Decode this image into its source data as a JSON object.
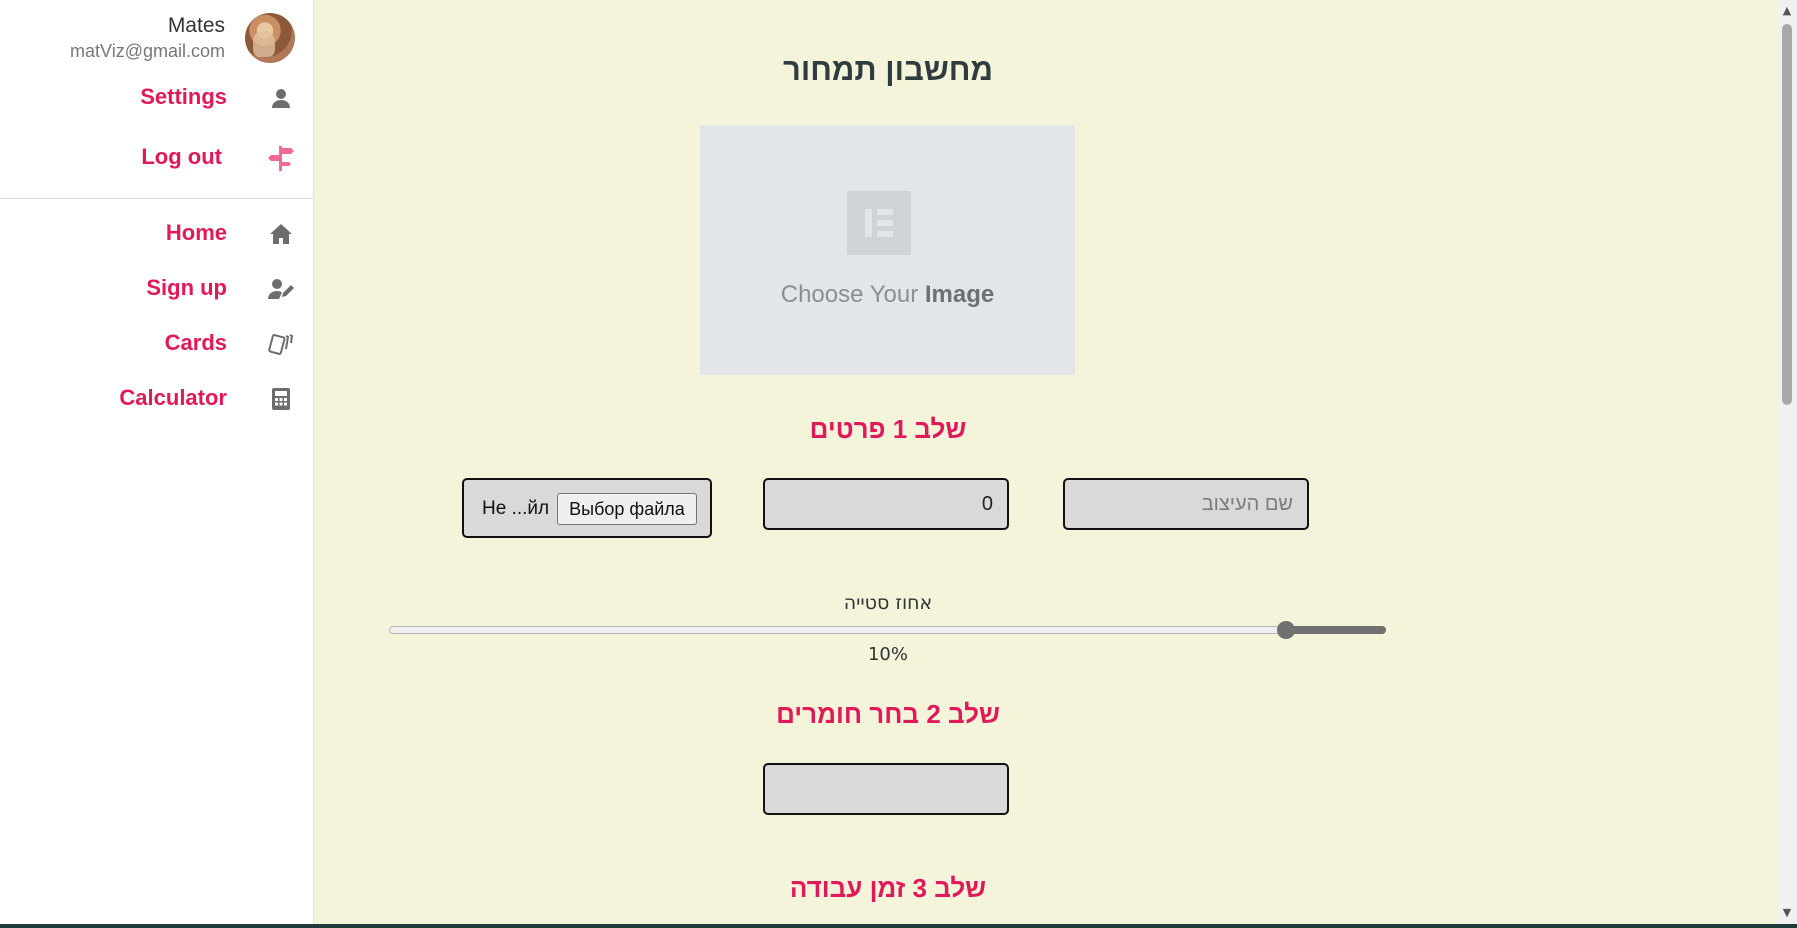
{
  "user": {
    "name": "Mates",
    "email": "matViz@gmail.com"
  },
  "account_menu": [
    {
      "label": "Settings",
      "icon": "person-icon"
    },
    {
      "label": "Log out",
      "icon": "signpost-icon"
    }
  ],
  "nav": [
    {
      "label": "Home",
      "icon": "home-icon"
    },
    {
      "label": "Sign up",
      "icon": "user-edit-icon"
    },
    {
      "label": "Cards",
      "icon": "cards-icon"
    },
    {
      "label": "Calculator",
      "icon": "calculator-icon"
    }
  ],
  "main": {
    "title": "מחשבון תמחור",
    "image_placeholder": {
      "caption_prefix": "Choose Your",
      "caption_bold": "Image"
    },
    "step1": {
      "heading": "שלב 1 פרטים",
      "design_name_placeholder": "שם העיצוב",
      "number_value": "0",
      "file_button_label": "Выбор файла",
      "file_status": "He ...йл"
    },
    "slider": {
      "label": "אחוז סטייה",
      "value": 0.9,
      "value_text": "10%"
    },
    "step2": {
      "heading": "שלב 2 בחר חומרים",
      "select_value": ""
    },
    "step3": {
      "heading": "שלב 3 זמן עבודה"
    }
  },
  "colors": {
    "accent": "#e0195a",
    "main_bg": "#f4f4da",
    "sidebar_bg": "#ffffff",
    "field_bg": "#d9d9d9"
  }
}
